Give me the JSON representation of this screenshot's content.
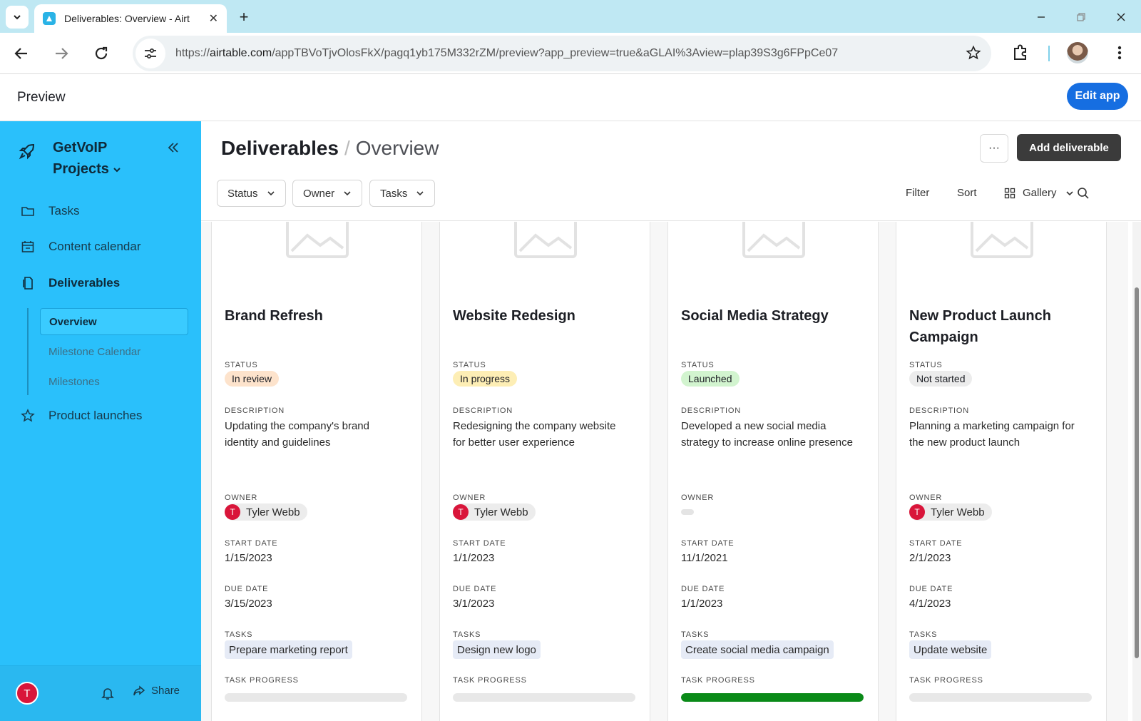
{
  "browser": {
    "tab_title": "Deliverables: Overview - Airtable",
    "url_domain": "airtable.com",
    "url_prefix": "https://",
    "url_path": "/appTBVoTjvOlosFkX/pagq1yb175M332rZM/preview?app_preview=true&aGLAI%3Aview=plap39S3g6FPpCe07"
  },
  "app_bar": {
    "title": "Preview",
    "edit_label": "Edit app"
  },
  "sidebar": {
    "workspace_name": "GetVoIP Projects",
    "nav": [
      {
        "label": "Tasks",
        "icon": "folder-icon"
      },
      {
        "label": "Content calendar",
        "icon": "calendar-icon"
      },
      {
        "label": "Deliverables",
        "icon": "document-icon"
      },
      {
        "label": "Product launches",
        "icon": "star-icon"
      }
    ],
    "sub_items": [
      "Overview",
      "Milestone Calendar",
      "Milestones"
    ],
    "user_initial": "T",
    "share_label": "Share"
  },
  "header": {
    "title": "Deliverables",
    "separator": "/",
    "subtitle": "Overview",
    "more_label": "···",
    "add_label": "Add deliverable",
    "filters": [
      "Status",
      "Owner",
      "Tasks"
    ],
    "filter_label": "Filter",
    "sort_label": "Sort",
    "view_label": "Gallery"
  },
  "field_labels": {
    "status": "Status",
    "description": "Description",
    "owner": "Owner",
    "start_date": "Start date",
    "due_date": "Due date",
    "tasks": "Tasks",
    "task_progress": "Task progress"
  },
  "colors": {
    "accent": "#166ee1",
    "sidebar": "#2ac0fb",
    "progress": "#0a8a18"
  },
  "cards": [
    {
      "title": "Brand Refresh",
      "status": "In review",
      "status_bg": "#fde3cc",
      "description": "Updating the company's brand identity and guidelines",
      "owner_initial": "T",
      "owner": "Tyler Webb",
      "start_date": "1/15/2023",
      "due_date": "3/15/2023",
      "task": "Prepare marketing report",
      "progress": 0
    },
    {
      "title": "Website Redesign",
      "status": "In progress",
      "status_bg": "#fdeeb5",
      "description": "Redesigning the company website for better user experience",
      "owner_initial": "T",
      "owner": "Tyler Webb",
      "start_date": "1/1/2023",
      "due_date": "3/1/2023",
      "task": "Design new logo",
      "progress": 0
    },
    {
      "title": "Social Media Strategy",
      "status": "Launched",
      "status_bg": "#d2f4cf",
      "description": "Developed a new social media strategy to increase online presence",
      "owner_initial": "",
      "owner": "",
      "start_date": "11/1/2021",
      "due_date": "1/1/2023",
      "task": "Create social media campaign",
      "progress": 1
    },
    {
      "title": "New Product Launch Campaign",
      "status": "Not started",
      "status_bg": "#ececec",
      "description": "Planning a marketing campaign for the new product launch",
      "owner_initial": "T",
      "owner": "Tyler Webb",
      "start_date": "2/1/2023",
      "due_date": "4/1/2023",
      "task": "Update website",
      "progress": 0
    }
  ]
}
